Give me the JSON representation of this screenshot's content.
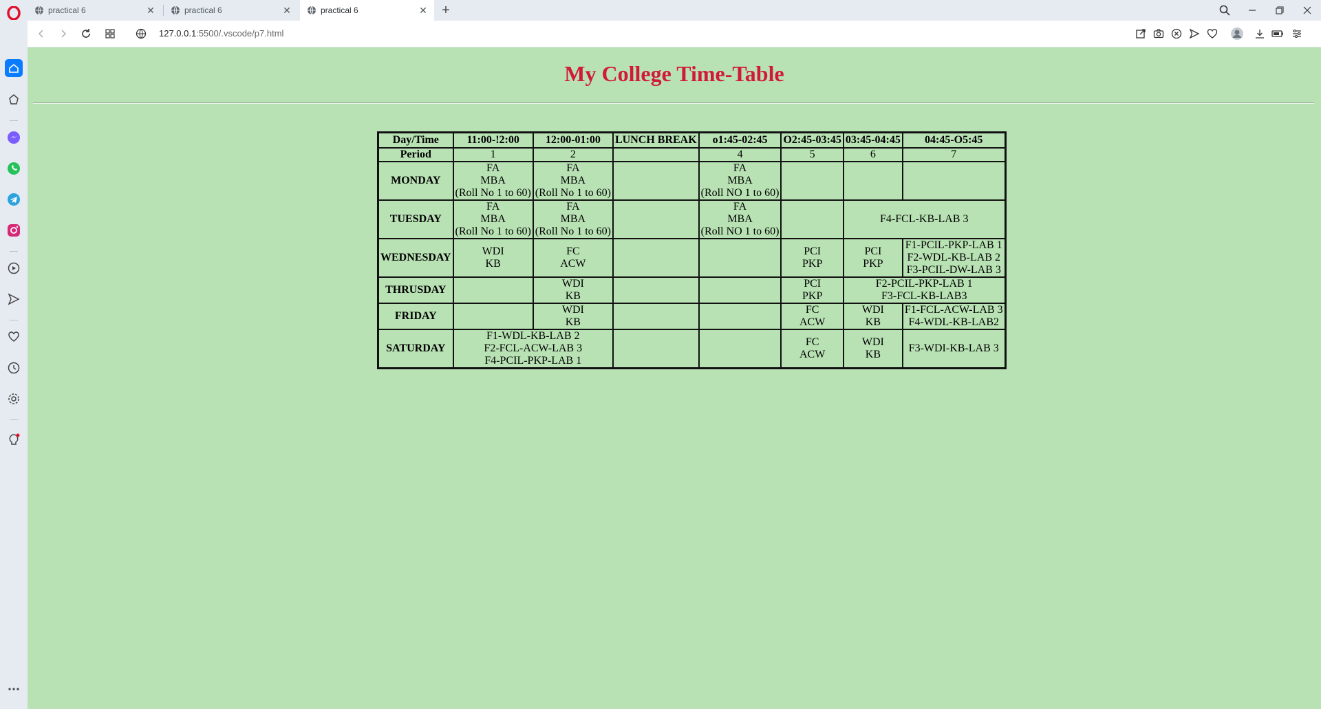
{
  "browser": {
    "tabs": [
      {
        "label": "practical 6",
        "active": false
      },
      {
        "label": "practical 6",
        "active": false
      },
      {
        "label": "practical 6",
        "active": true
      }
    ],
    "url_host": "127.0.0.1",
    "url_rest": ":5500/.vscode/p7.html",
    "accent_color": "#0a7cff",
    "logo_color": "#e0122d"
  },
  "page": {
    "title": "My College Time-Table",
    "background": "#b8e2b4",
    "title_color": "#d11a3b"
  },
  "timetable": {
    "header": {
      "day_time": "Day/Time",
      "slots": [
        "11:00-!2:00",
        "12:00-01:00",
        "LUNCH BREAK",
        "o1:45-02:45",
        "O2:45-03:45",
        "03:45-04:45",
        "04:45-O5:45"
      ]
    },
    "period": {
      "label": "Period",
      "values": [
        "1",
        "2",
        "",
        "4",
        "5",
        "6",
        "7"
      ]
    },
    "rows": {
      "monday": {
        "day": "MONDAY",
        "c1": [
          "FA",
          "MBA",
          "(Roll No 1 to 60)"
        ],
        "c2": [
          "FA",
          "MBA",
          "(Roll No 1 to 60)"
        ],
        "c4": [
          "FA",
          "MBA",
          "(Roll NO 1 to 60)"
        ]
      },
      "tuesday": {
        "day": "TUESDAY",
        "c1": [
          "FA",
          "MBA",
          "(Roll No 1 to 60)"
        ],
        "c2": [
          "FA",
          "MBA",
          "(Roll No 1 to 60)"
        ],
        "c4": [
          "FA",
          "MBA",
          "(Roll NO 1 to 60)"
        ],
        "c67": [
          "F4-FCL-KB-LAB 3"
        ]
      },
      "wednesday": {
        "day": "WEDNESDAY",
        "c1": [
          "WDI",
          "KB"
        ],
        "c2": [
          "FC",
          "ACW"
        ],
        "c5": [
          "PCI",
          "PKP"
        ],
        "c6": [
          "PCI",
          "PKP"
        ],
        "c7": [
          "F1-PCIL-PKP-LAB 1",
          "F2-WDL-KB-LAB 2",
          "F3-PCIL-DW-LAB 3"
        ]
      },
      "thursday": {
        "day": "THRUSDAY",
        "c2": [
          "WDI",
          "KB"
        ],
        "c5": [
          "PCI",
          "PKP"
        ],
        "c67": [
          "F2-PCIL-PKP-LAB 1",
          "F3-FCL-KB-LAB3"
        ]
      },
      "friday": {
        "day": "FRIDAY",
        "c2": [
          "WDI",
          "KB"
        ],
        "c5": [
          "FC",
          "ACW"
        ],
        "c6": [
          "WDI",
          "KB"
        ],
        "c7": [
          "F1-FCL-ACW-LAB 3",
          "F4-WDL-KB-LAB2"
        ]
      },
      "saturday": {
        "day": "SATURDAY",
        "c12": [
          "F1-WDL-KB-LAB 2",
          "F2-FCL-ACW-LAB 3",
          "F4-PCIL-PKP-LAB 1"
        ],
        "c5": [
          "FC",
          "ACW"
        ],
        "c6": [
          "WDI",
          "KB"
        ],
        "c7": [
          "F3-WDI-KB-LAB 3"
        ]
      }
    }
  }
}
